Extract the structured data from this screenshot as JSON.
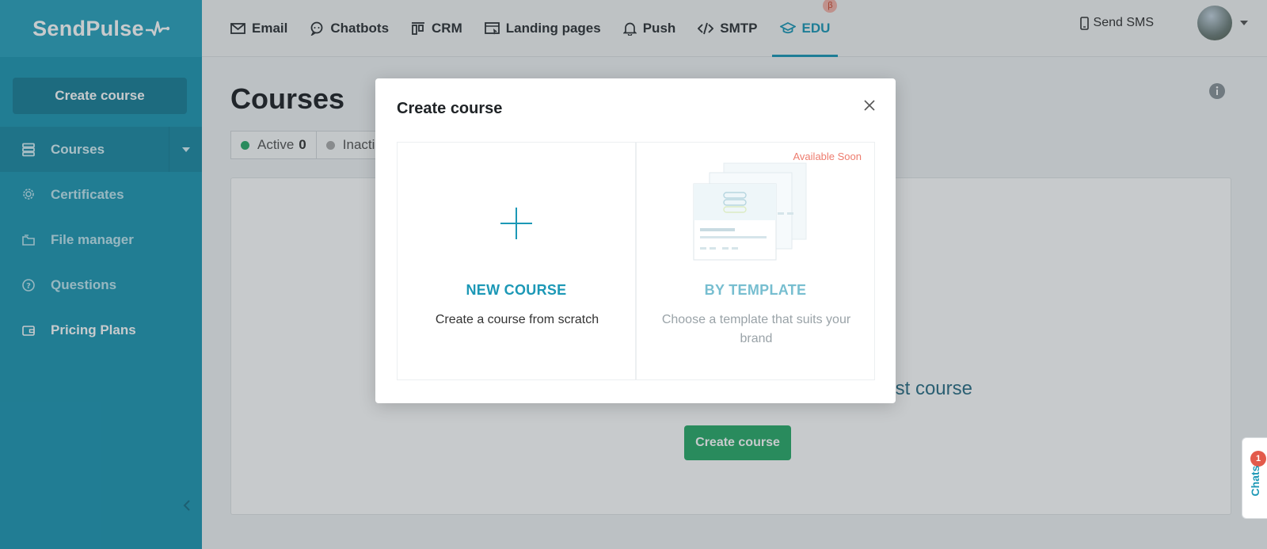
{
  "app": {
    "brand": "SendPulse",
    "accent_color": "#1c98b6",
    "sidebar_color": "#1f97b3",
    "success_color": "#2aab6a"
  },
  "topnav": {
    "items": [
      {
        "label": "Email",
        "icon": "envelope-icon"
      },
      {
        "label": "Chatbots",
        "icon": "chatbot-icon"
      },
      {
        "label": "CRM",
        "icon": "crm-icon"
      },
      {
        "label": "Landing pages",
        "icon": "landing-icon"
      },
      {
        "label": "Push",
        "icon": "bell-icon"
      },
      {
        "label": "SMTP",
        "icon": "code-icon"
      },
      {
        "label": "EDU",
        "icon": "graduation-cap-icon",
        "badge": "β",
        "active": true
      }
    ],
    "send_sms": "Send SMS"
  },
  "sidebar": {
    "create_button": "Create course",
    "items": [
      {
        "label": "Courses",
        "icon": "stack-icon"
      },
      {
        "label": "Certificates",
        "icon": "badge-icon"
      },
      {
        "label": "File manager",
        "icon": "folder-icon"
      },
      {
        "label": "Questions",
        "icon": "question-icon"
      },
      {
        "label": "Pricing Plans",
        "icon": "wallet-icon"
      }
    ]
  },
  "main": {
    "title": "Courses",
    "filters": [
      {
        "label": "Active",
        "count": "0",
        "color": "#2aab6a"
      },
      {
        "label": "Inacti",
        "color": "#aaaaaa"
      }
    ],
    "empty_text": "rst course",
    "create_button": "Create course"
  },
  "modal": {
    "title": "Create course",
    "cards": [
      {
        "title": "NEW COURSE",
        "desc": "Create a course from scratch"
      },
      {
        "title": "BY TEMPLATE",
        "desc": "Choose a template that suits your brand",
        "tag": "Available Soon"
      }
    ]
  },
  "chats": {
    "label": "Chats",
    "badge": "1"
  }
}
